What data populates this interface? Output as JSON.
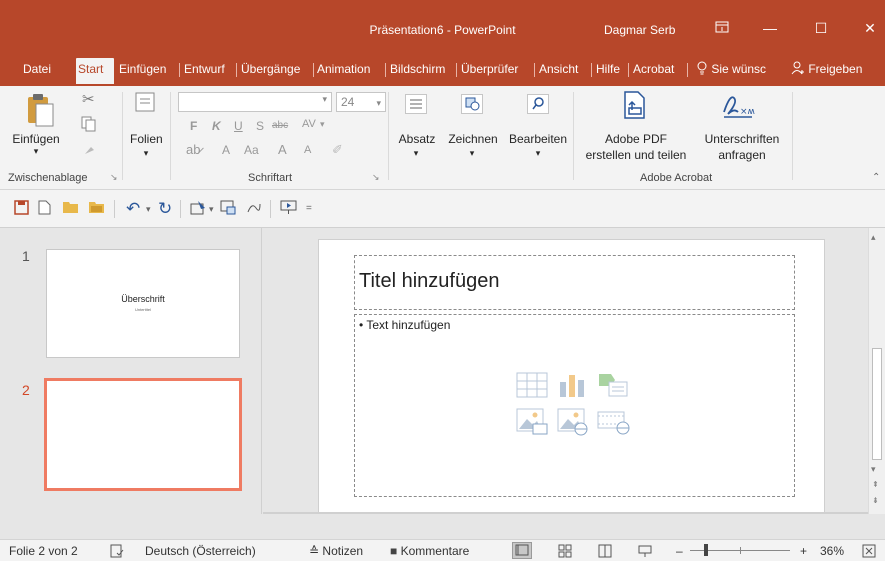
{
  "window": {
    "title": "Präsentation6 - PowerPoint",
    "user": "Dagmar Serb",
    "ribbon_display_icon": "ribbon-display-icon",
    "minimize": "—",
    "maximize": "☐",
    "close": "✕"
  },
  "tabs": [
    {
      "label": "Datei"
    },
    {
      "label": "Start",
      "active": true
    },
    {
      "label": "Einfügen"
    },
    {
      "label": "Entwurf"
    },
    {
      "label": "Übergänge"
    },
    {
      "label": "Animation"
    },
    {
      "label": "Bildschirm"
    },
    {
      "label": "Überprüfer"
    },
    {
      "label": "Ansicht"
    },
    {
      "label": "Hilfe"
    },
    {
      "label": "Acrobat"
    }
  ],
  "tell_me": "Sie wünsc",
  "share": "Freigeben",
  "ribbon": {
    "clipboard": {
      "paste": "Einfügen",
      "group": "Zwischenablage"
    },
    "slides": {
      "new_slide": "Folien"
    },
    "font": {
      "font_name": "",
      "font_size": "24",
      "bold": "F",
      "italic": "K",
      "underline": "U",
      "shadow": "S",
      "strike": "abc",
      "spacing": "AV",
      "case": "Aa",
      "grow": "A",
      "shrink": "A",
      "group": "Schriftart"
    },
    "paragraph": {
      "label": "Absatz"
    },
    "drawing": {
      "label": "Zeichnen"
    },
    "editing": {
      "label": "Bearbeiten"
    },
    "acrobat": {
      "create_pdf_1": "Adobe PDF",
      "create_pdf_2": "erstellen und teilen",
      "sign_1": "Unterschriften",
      "sign_2": "anfragen",
      "group": "Adobe Acrobat"
    }
  },
  "thumbnails": [
    {
      "number": "1",
      "title": "Überschrift",
      "subtitle": "Untertitel"
    },
    {
      "number": "2",
      "title": "",
      "subtitle": ""
    }
  ],
  "slide": {
    "title_placeholder": "Titel hinzufügen",
    "text_placeholder": "• Text hinzufügen"
  },
  "status": {
    "slide_info": "Folie 2 von 2",
    "language": "Deutsch (Österreich)",
    "notes": "Notizen",
    "comments": "Kommentare",
    "zoom": "36%"
  },
  "colors": {
    "accent": "#b7472a",
    "selection": "#ef7b62"
  }
}
